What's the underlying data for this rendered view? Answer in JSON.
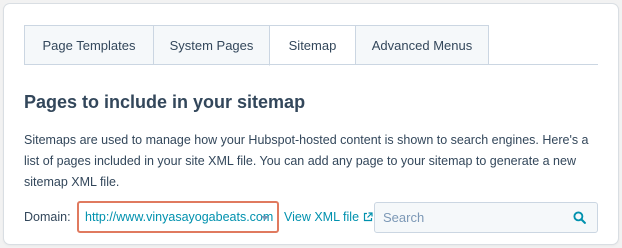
{
  "tabs": [
    {
      "label": "Page Templates",
      "active": false
    },
    {
      "label": "System Pages",
      "active": false
    },
    {
      "label": "Sitemap",
      "active": true
    },
    {
      "label": "Advanced Menus",
      "active": false
    }
  ],
  "section": {
    "title": "Pages to include in your sitemap",
    "description": "Sitemaps are used to manage how your Hubspot-hosted content is shown to search engines. Here's a list of pages included in your site XML file. You can add any page to your sitemap to generate a new sitemap XML file."
  },
  "domain": {
    "label": "Domain:",
    "selected_value": "http://www.vinyasayogabeats.com",
    "view_xml_label": "View XML file"
  },
  "search": {
    "placeholder": "Search",
    "value": ""
  },
  "colors": {
    "link": "#0091ae",
    "text": "#33475b",
    "highlight_border": "#e07a5f",
    "tab_border": "#cbd6e2"
  },
  "icons": {
    "external_link": "external-link-icon",
    "search": "search-icon",
    "dropdown": "chevron-down-icon"
  }
}
